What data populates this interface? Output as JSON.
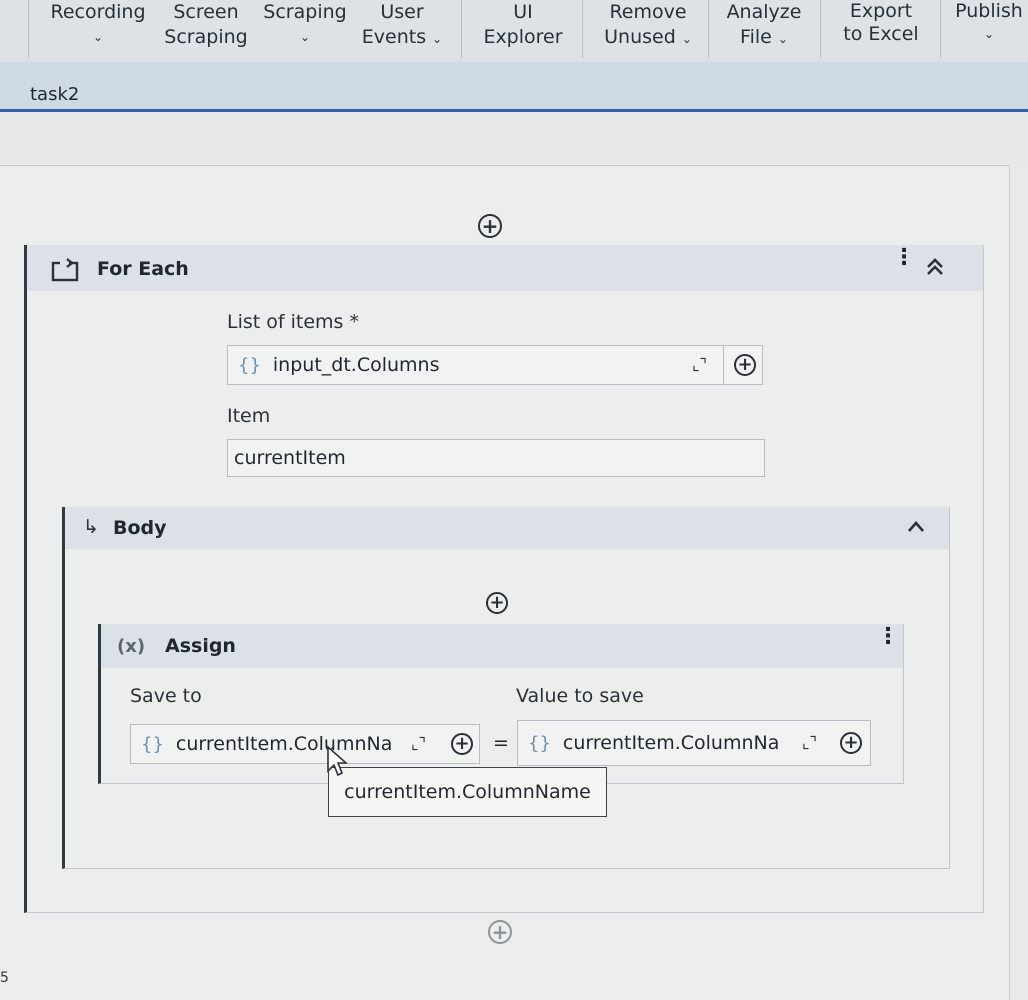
{
  "ribbon": {
    "buttons": [
      {
        "line1": "Recording",
        "line2": "",
        "dropdown": true
      },
      {
        "line1": "Screen",
        "line2": "Scraping",
        "dropdown": false
      },
      {
        "line1": "Scraping",
        "line2": "",
        "dropdown": true
      },
      {
        "line1": "User",
        "line2": "Events",
        "dropdown": true
      },
      {
        "line1": "UI",
        "line2": "Explorer",
        "dropdown": false
      },
      {
        "line1": "Remove",
        "line2": "Unused",
        "dropdown": true
      },
      {
        "line1": "Analyze",
        "line2": "File",
        "dropdown": true
      },
      {
        "line1": "Export",
        "line2": "to Excel",
        "dropdown": false
      },
      {
        "line1": "Publish",
        "line2": "",
        "dropdown": true
      }
    ]
  },
  "tab": {
    "label": "task2"
  },
  "foreach": {
    "title": "For Each",
    "list_label": "List of items *",
    "list_value": "input_dt.Columns",
    "item_label": "Item",
    "item_value": "currentItem"
  },
  "body": {
    "title": "Body"
  },
  "assign": {
    "icon_text": "(x)",
    "title": "Assign",
    "save_to_label": "Save to",
    "save_to_value": "currentItem.ColumnNa",
    "equals": "=",
    "value_label": "Value to save",
    "value_value": "currentItem.ColumnNa"
  },
  "tooltip": {
    "text": "currentItem.ColumnName"
  },
  "edge_text": "5",
  "colors": {
    "accent": "#2f63a8",
    "header": "#dbe1e6",
    "brace": "#6b8fb8"
  }
}
